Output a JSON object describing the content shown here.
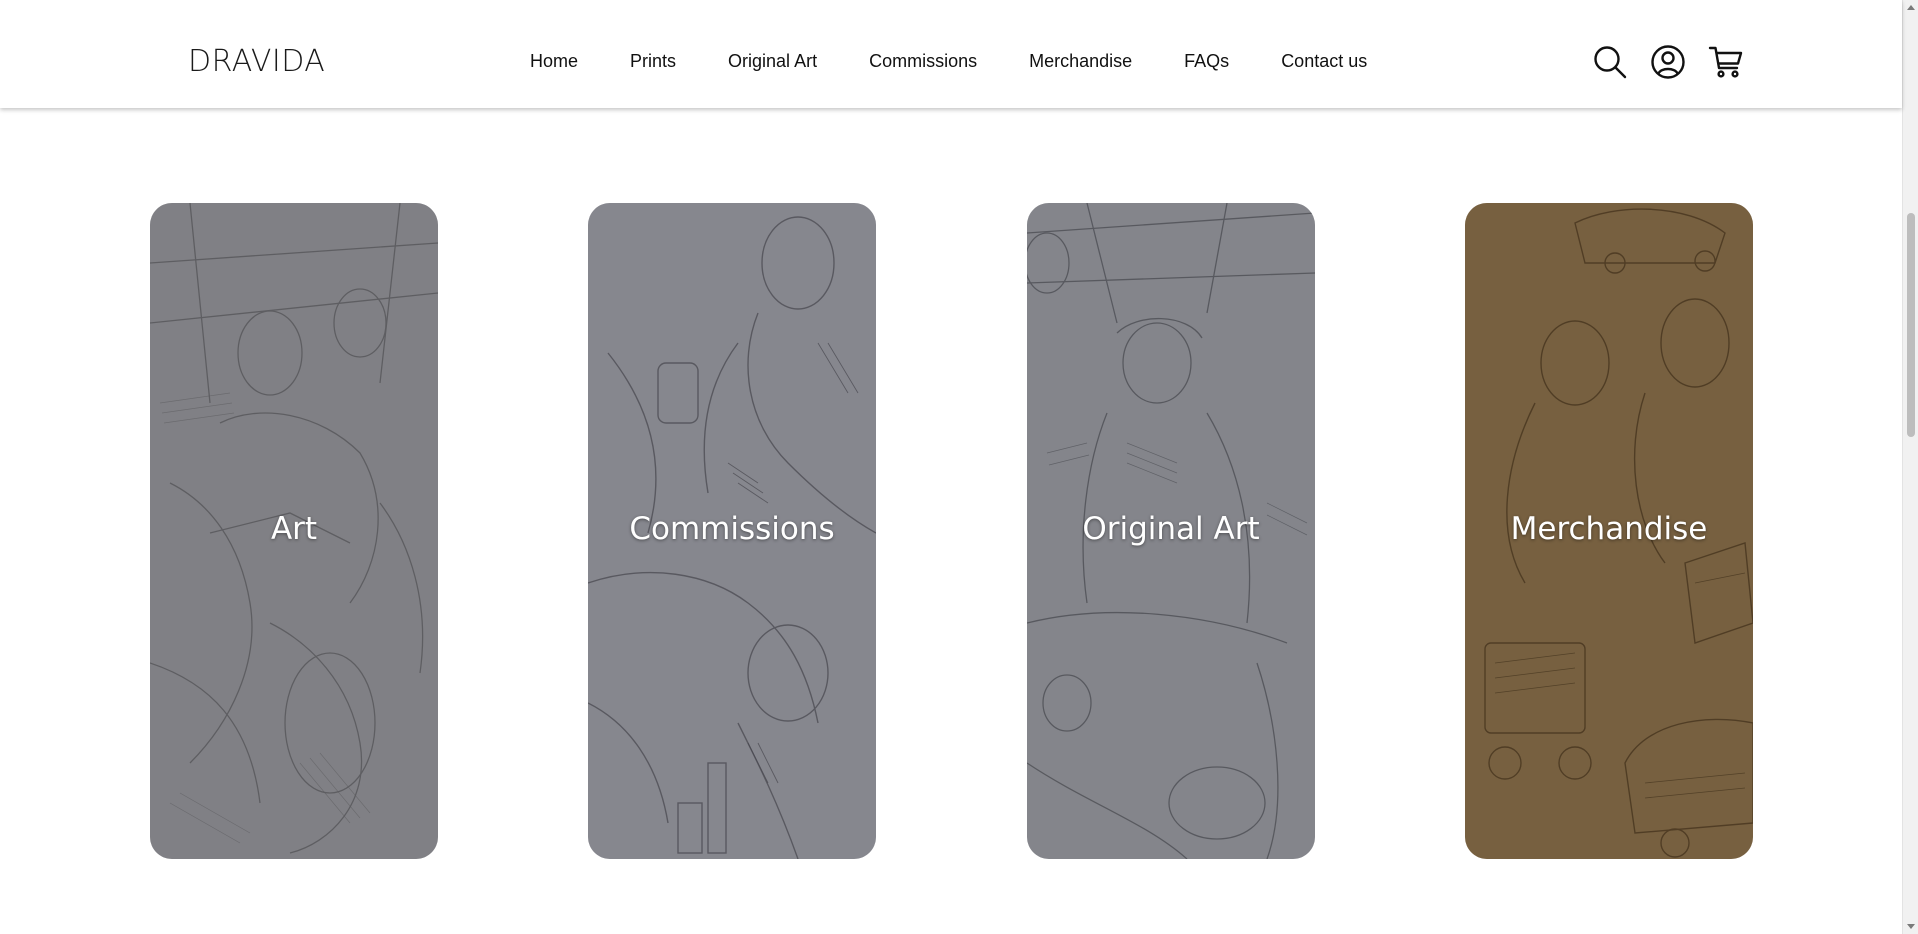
{
  "header": {
    "logo": "DRAVIDA",
    "nav": [
      {
        "label": "Home"
      },
      {
        "label": "Prints"
      },
      {
        "label": "Original Art"
      },
      {
        "label": "Commissions"
      },
      {
        "label": "Merchandise"
      },
      {
        "label": "FAQs"
      },
      {
        "label": "Contact us"
      }
    ],
    "icons": [
      "search-icon",
      "account-icon",
      "cart-icon"
    ]
  },
  "cards": [
    {
      "title": "Art",
      "tone": "#8a8a8c",
      "overlay": "rgba(95,95,100,0.55)"
    },
    {
      "title": "Commissions",
      "tone": "#8c8d92",
      "overlay": "rgba(100,100,108,0.55)"
    },
    {
      "title": "Original Art",
      "tone": "#8b8c90",
      "overlay": "rgba(98,99,106,0.55)"
    },
    {
      "title": "Merchandise",
      "tone": "#7a6648",
      "overlay": "rgba(90,70,40,0.55)"
    }
  ],
  "colors": {
    "header_bg": "#ffffff",
    "text": "#111111",
    "card_title": "#ffffff"
  }
}
